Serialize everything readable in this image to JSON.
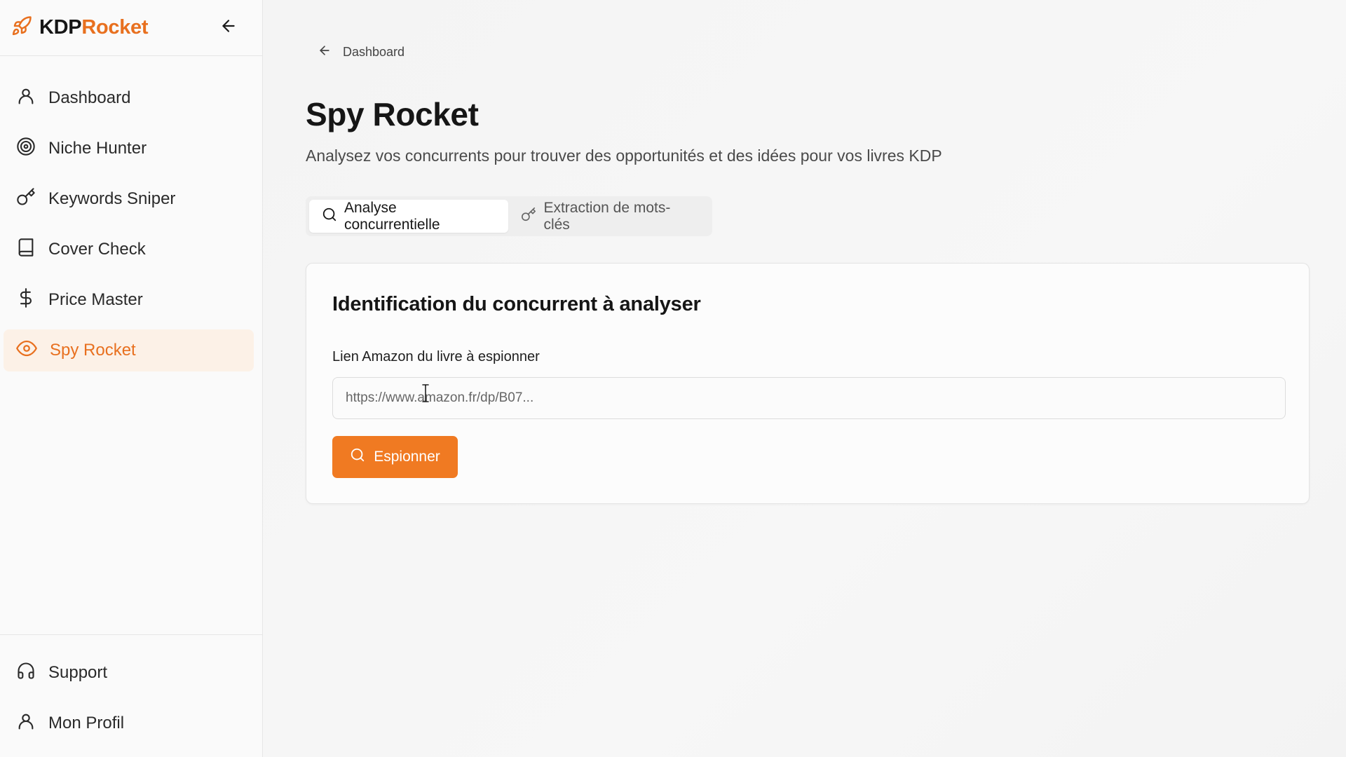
{
  "brand": {
    "name_part1": "KDP",
    "name_part2": "Rocket",
    "accent": "#e8701f"
  },
  "sidebar": {
    "items": [
      {
        "label": "Dashboard",
        "icon": "user-icon"
      },
      {
        "label": "Niche Hunter",
        "icon": "target-icon"
      },
      {
        "label": "Keywords Sniper",
        "icon": "key-icon"
      },
      {
        "label": "Cover Check",
        "icon": "book-icon"
      },
      {
        "label": "Price Master",
        "icon": "dollar-icon"
      },
      {
        "label": "Spy Rocket",
        "icon": "eye-icon",
        "active": true
      }
    ],
    "bottom_items": [
      {
        "label": "Support",
        "icon": "headphones-icon"
      },
      {
        "label": "Mon Profil",
        "icon": "user-icon"
      }
    ]
  },
  "breadcrumb": {
    "label": "Dashboard"
  },
  "page": {
    "title": "Spy Rocket",
    "subtitle": "Analysez vos concurrents pour trouver des opportunités et des idées pour vos livres KDP"
  },
  "tabs": [
    {
      "label": "Analyse concurrentielle",
      "icon": "search-icon",
      "active": true
    },
    {
      "label": "Extraction de mots-clés",
      "icon": "key-icon",
      "active": false
    }
  ],
  "card": {
    "title": "Identification du concurrent à analyser",
    "field_label": "Lien Amazon du livre à espionner",
    "input_placeholder": "https://www.amazon.fr/dp/B07...",
    "input_value": "",
    "button_label": "Espionner",
    "button_color": "#f07a22"
  }
}
